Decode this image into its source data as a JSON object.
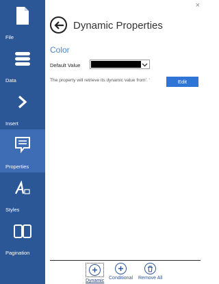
{
  "sidebar": {
    "items": [
      {
        "label": "File",
        "icon": "file-icon"
      },
      {
        "label": "Data",
        "icon": "database-icon"
      },
      {
        "label": "Insert",
        "icon": "chevron-right-icon"
      },
      {
        "label": "Properties",
        "icon": "comment-icon",
        "active": true
      },
      {
        "label": "Styles",
        "icon": "styles-icon"
      },
      {
        "label": "Pagination",
        "icon": "book-icon"
      }
    ]
  },
  "panel": {
    "close_label": "×",
    "title": "Dynamic Properties",
    "section": "Color",
    "field_label": "Default Value",
    "default_value_color": "#000000",
    "info_text": "The property will retrieve its dynamic value from'. '",
    "edit_label": "Edit"
  },
  "footer": {
    "dynamic_label": "Dynamic",
    "conditional_label": "Conditional",
    "remove_all_label": "Remove All"
  },
  "colors": {
    "sidebar_bg": "#2b5797",
    "sidebar_active": "#3e6db5",
    "accent": "#4a87c4",
    "edit_button": "#2e75d6"
  }
}
